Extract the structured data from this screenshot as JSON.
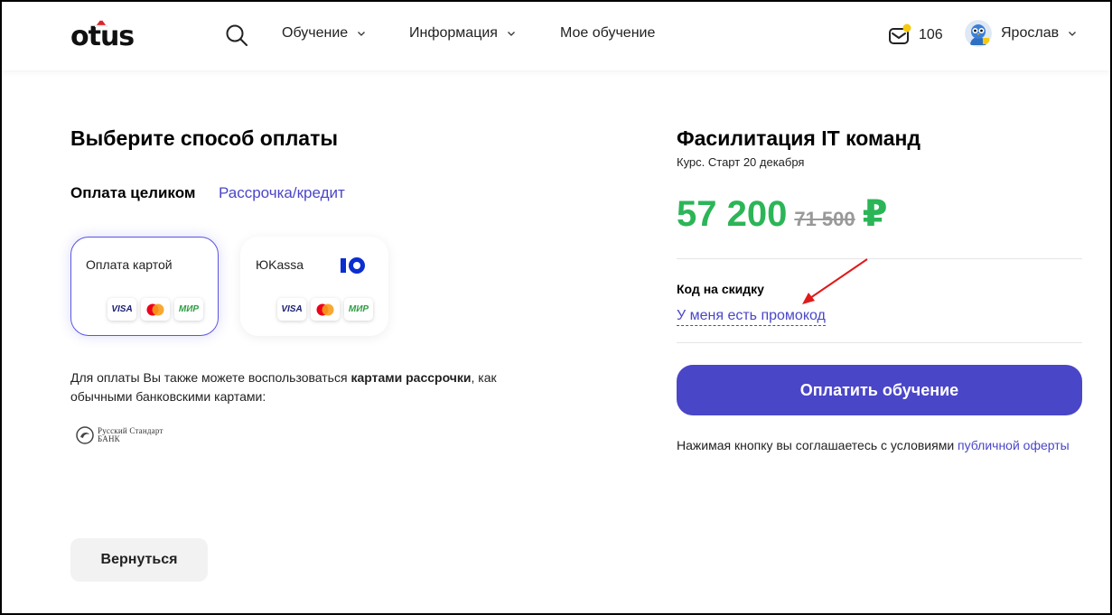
{
  "header": {
    "logo_text": "otus",
    "nav": [
      {
        "label": "Обучение",
        "has_dropdown": true
      },
      {
        "label": "Информация",
        "has_dropdown": true
      },
      {
        "label": "Мое обучение",
        "has_dropdown": false
      }
    ],
    "notifications_count": "106",
    "user_name": "Ярослав",
    "icons": {
      "search": "search-icon",
      "mail": "mail-icon",
      "chevron": "chevron-down-icon"
    },
    "colors": {
      "notification_dot": "#f6c90e"
    }
  },
  "payment": {
    "title": "Выберите способ оплаты",
    "tabs": [
      {
        "label": "Оплата целиком",
        "active": true
      },
      {
        "label": "Рассрочка/кредит",
        "active": false
      }
    ],
    "methods": [
      {
        "title": "Оплата картой",
        "selected": true,
        "badges": [
          "VISA",
          "mastercard",
          "МИР"
        ]
      },
      {
        "title": "ЮKassa",
        "selected": false,
        "badges": [
          "VISA",
          "mastercard",
          "МИР"
        ]
      }
    ],
    "note_prefix": "Для оплаты Вы также можете воспользоваться ",
    "note_bold": "картами рассрочки",
    "note_suffix": ", как обычными банковскими картами:",
    "bank_line1": "Русский Стандарт",
    "bank_line2": "БАНК",
    "back_label": "Вернуться"
  },
  "order": {
    "course_title": "Фасилитация IT команд",
    "course_subtitle": "Курс. Старт 20 декабря",
    "price": "57 200",
    "old_price": "71 500",
    "currency": "₽",
    "promo_label": "Код на скидку",
    "promo_link": "У меня есть промокод",
    "pay_label": "Оплатить обучение",
    "agree_text": "Нажимая кнопку вы соглашаетесь с условиями ",
    "agree_link": "публичной оферты"
  },
  "colors": {
    "accent": "#4a46c8",
    "price_green": "#2cb557",
    "annotation_arrow": "#e01a1a"
  }
}
